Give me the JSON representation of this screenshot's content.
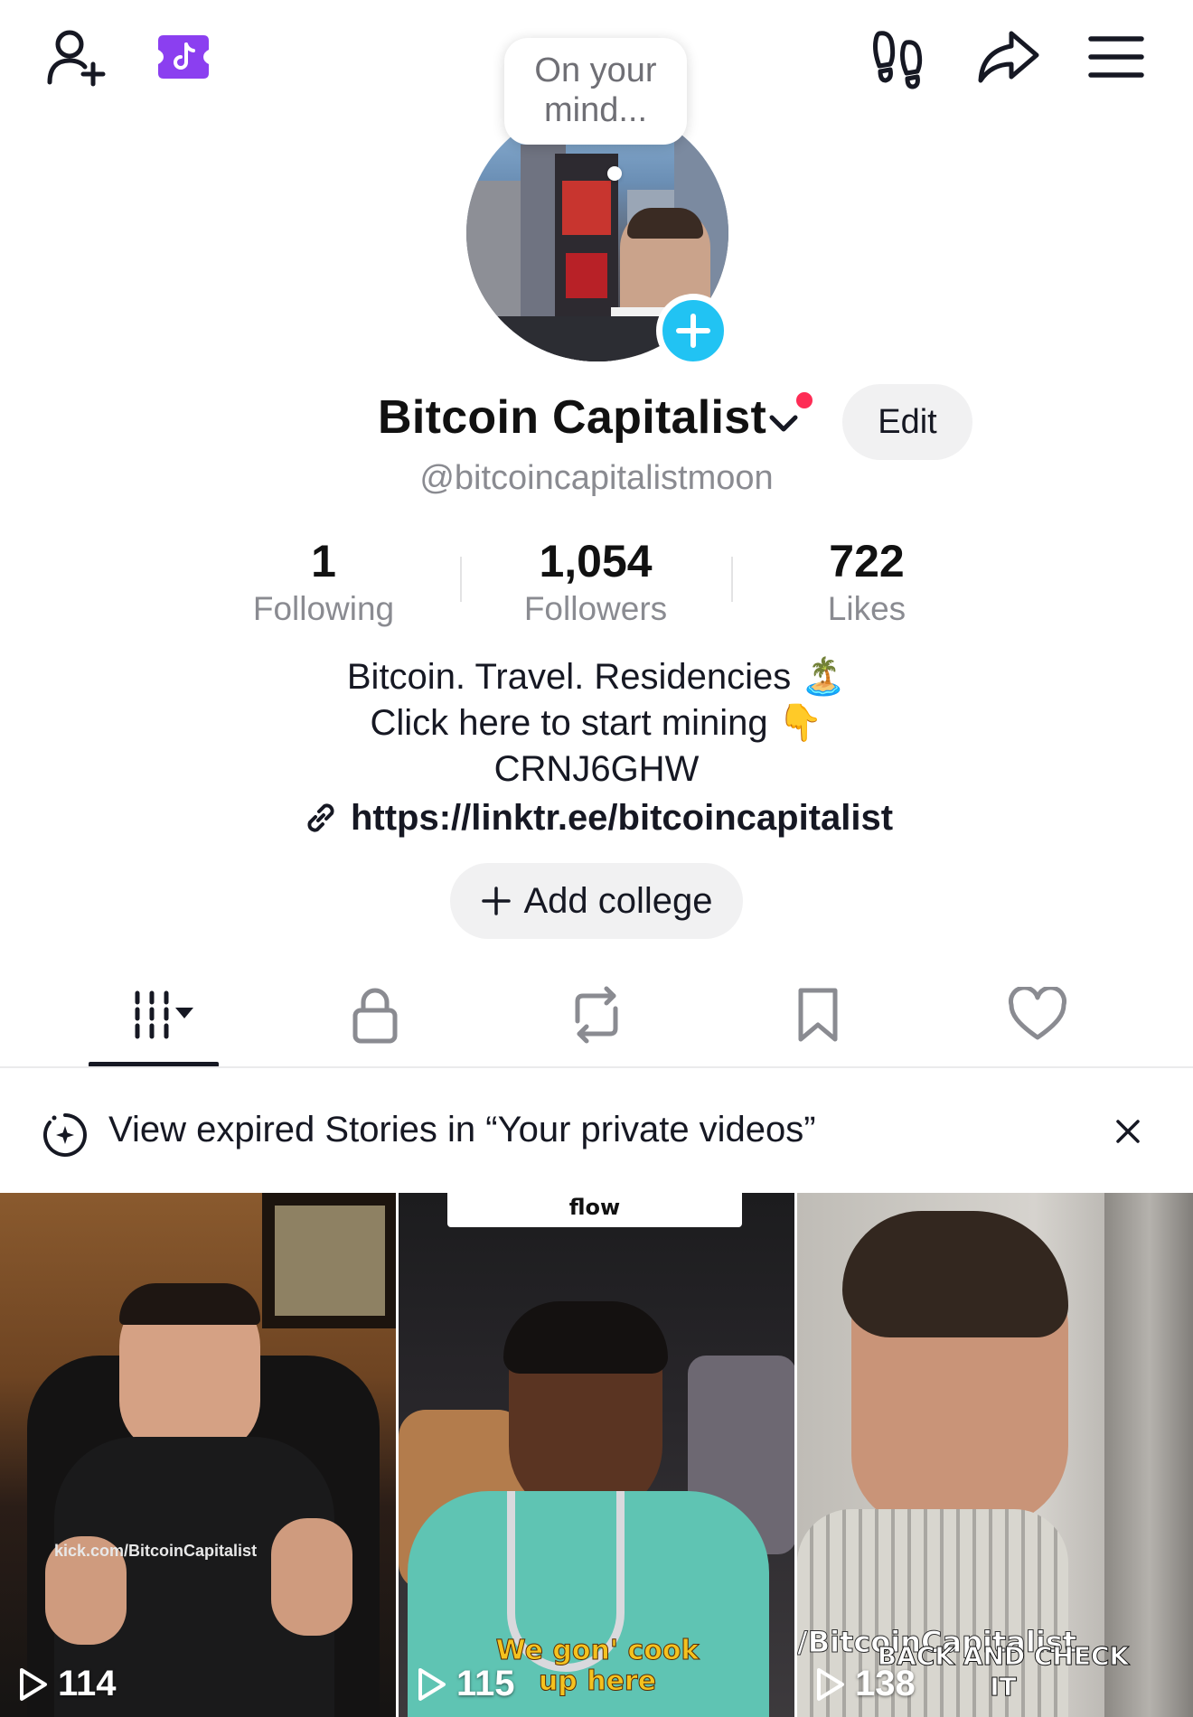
{
  "bubble": {
    "line1": "On your",
    "line2": "mind..."
  },
  "profile": {
    "name": "Bitcoin Capitalist",
    "handle": "@bitcoincapitalistmoon",
    "edit_label": "Edit"
  },
  "stats": [
    {
      "value": "1",
      "label": "Following"
    },
    {
      "value": "1,054",
      "label": "Followers"
    },
    {
      "value": "722",
      "label": "Likes"
    }
  ],
  "bio": {
    "line1": "Bitcoin. Travel. Residencies 🏝️",
    "line2": "Click here to start mining 👇",
    "line3": "CRNJ6GHW",
    "link": "https://linktr.ee/bitcoincapitalist"
  },
  "add_college_label": "Add college",
  "notice": {
    "text": "View expired Stories in “Your private videos”"
  },
  "videos": [
    {
      "views": "114",
      "overlay": "kick.com/BitcoinCapitalist"
    },
    {
      "views": "115",
      "title_card": "flow",
      "caption": "We gon' cook up here"
    },
    {
      "views": "138",
      "overlay": "/BitcoinCapitalist",
      "caption": "BACK AND CHECK IT"
    }
  ],
  "icons": {
    "add_friend": "add-friend-icon",
    "tiktok_now": "tiktok-app-icon",
    "footprints": "footprints-icon",
    "share": "share-icon",
    "menu": "menu-icon"
  },
  "colors": {
    "accent_cyan": "#21c3f3",
    "notification_red": "#fe2c55",
    "tiktok_purple": "#8b3ff0"
  }
}
